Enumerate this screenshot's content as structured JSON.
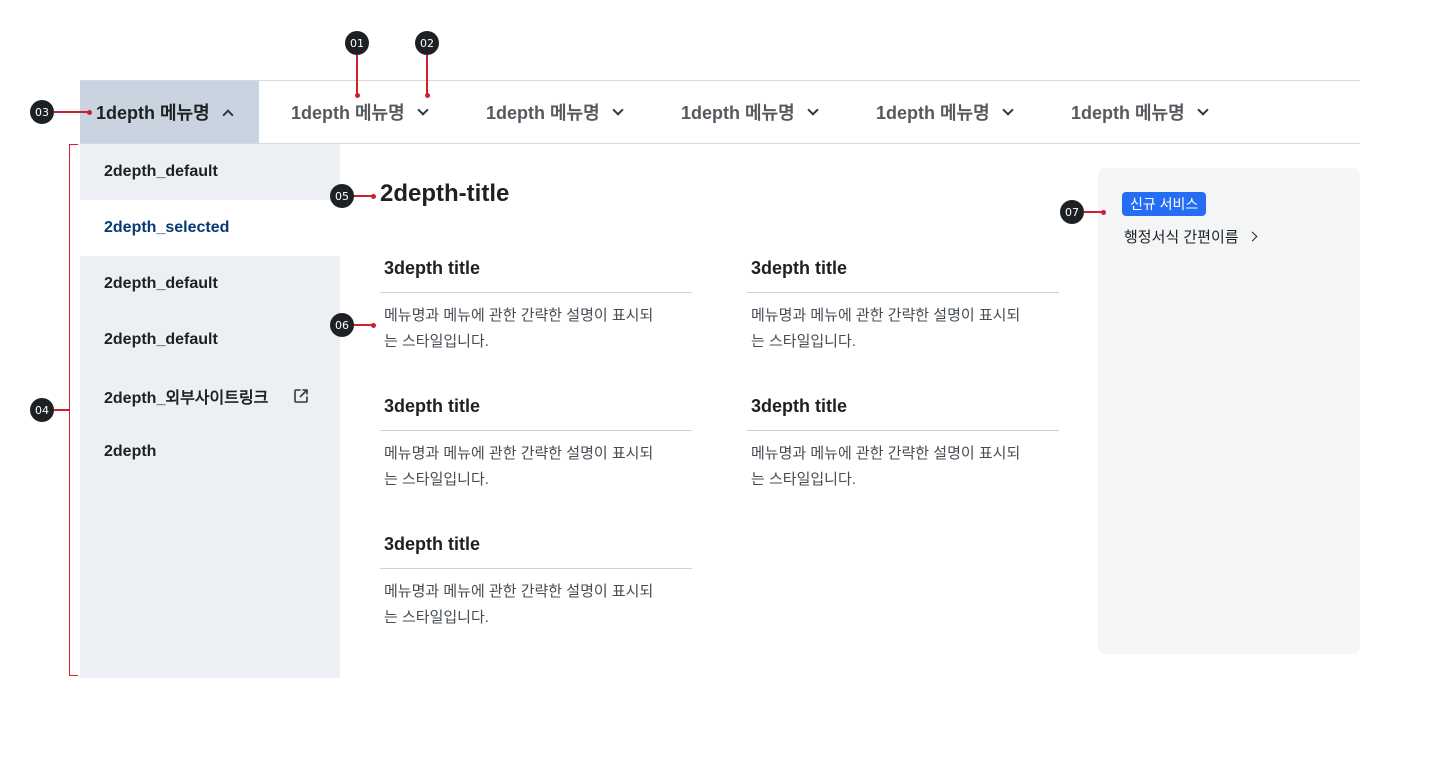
{
  "gnb": {
    "items": [
      {
        "label": "1depth 메뉴명",
        "active": true
      },
      {
        "label": "1depth 메뉴명"
      },
      {
        "label": "1depth 메뉴명"
      },
      {
        "label": "1depth 메뉴명"
      },
      {
        "label": "1depth 메뉴명"
      },
      {
        "label": "1depth 메뉴명"
      }
    ]
  },
  "side": {
    "items": [
      {
        "label": "2depth_default"
      },
      {
        "label": "2depth_selected",
        "selected": true
      },
      {
        "label": "2depth_default"
      },
      {
        "label": "2depth_default"
      },
      {
        "label": "2depth_외부사이트링크",
        "icon": "external-link-icon"
      },
      {
        "label": "2depth"
      }
    ]
  },
  "main": {
    "title": "2depth-title",
    "cards": [
      {
        "title": "3depth title",
        "desc_line1": "메뉴명과 메뉴에 관한 간략한 설명이 표시되",
        "desc_line2": "는 스타일입니다."
      },
      {
        "title": "3depth title",
        "desc_line1": "메뉴명과 메뉴에 관한 간략한 설명이 표시되",
        "desc_line2": "는 스타일입니다."
      },
      {
        "title": "3depth title",
        "desc_line1": "메뉴명과 메뉴에 관한 간략한 설명이 표시되",
        "desc_line2": "는 스타일입니다."
      },
      {
        "title": "3depth title",
        "desc_line1": "메뉴명과 메뉴에 관한 간략한 설명이 표시되",
        "desc_line2": "는 스타일입니다."
      },
      {
        "title": "3depth title",
        "desc_line1": "메뉴명과 메뉴에 관한 간략한 설명이 표시되",
        "desc_line2": "는 스타일입니다."
      }
    ]
  },
  "banner": {
    "badge": "신규 서비스",
    "link": "행정서식 간편이름"
  },
  "markers": [
    "01",
    "02",
    "03",
    "04",
    "05",
    "06",
    "07"
  ],
  "colors": {
    "active_nav_bg": "#cad4e0",
    "side_bg": "#eceff3",
    "selected_text": "#063a74",
    "badge_bg": "#256ef4",
    "marker_line": "#d0202e"
  }
}
